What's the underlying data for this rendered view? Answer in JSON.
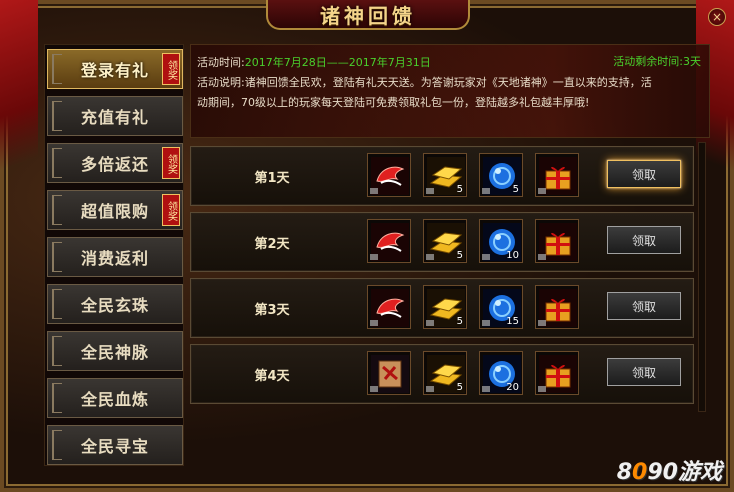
{
  "window": {
    "title": "诸神回馈",
    "close_label": "×"
  },
  "sidebar": {
    "items": [
      {
        "label": "登录有礼",
        "badge": "领奖",
        "active": true
      },
      {
        "label": "充值有礼",
        "badge": ""
      },
      {
        "label": "多倍返还",
        "badge": "领奖"
      },
      {
        "label": "超值限购",
        "badge": "领奖"
      },
      {
        "label": "消费返利",
        "badge": ""
      },
      {
        "label": "全民玄珠",
        "badge": ""
      },
      {
        "label": "全民神脉",
        "badge": ""
      },
      {
        "label": "全民血炼",
        "badge": ""
      },
      {
        "label": "全民寻宝",
        "badge": ""
      }
    ]
  },
  "info": {
    "time_label": "活动时间:",
    "time_value": "2017年7月28日——2017年7月31日",
    "remain_label": "活动剩余时间:",
    "remain_value": "3天",
    "desc_label": "活动说明:",
    "desc_line1": "诸神回馈全民欢，登陆有礼天天送。为答谢玩家对《天地诸神》一直以来的支持，活",
    "desc_line2": "动期间，70级以上的玩家每天登陆可免费领取礼包一份，登陆越多礼包越丰厚哦!"
  },
  "rows": [
    {
      "day": "第1天",
      "items": [
        {
          "icon": "red-wing-icon",
          "qty": ""
        },
        {
          "icon": "gold-bars-icon",
          "qty": "5"
        },
        {
          "icon": "blue-orb-icon",
          "qty": "5"
        },
        {
          "icon": "gift-box-icon",
          "qty": ""
        }
      ],
      "button": "领取",
      "highlight": true
    },
    {
      "day": "第2天",
      "items": [
        {
          "icon": "red-wing-icon",
          "qty": ""
        },
        {
          "icon": "gold-bars-icon",
          "qty": "5"
        },
        {
          "icon": "blue-orb-icon",
          "qty": "10"
        },
        {
          "icon": "gift-box-icon",
          "qty": ""
        }
      ],
      "button": "领取"
    },
    {
      "day": "第3天",
      "items": [
        {
          "icon": "red-wing-icon",
          "qty": ""
        },
        {
          "icon": "gold-bars-icon",
          "qty": "5"
        },
        {
          "icon": "blue-orb-icon",
          "qty": "15"
        },
        {
          "icon": "gift-box-icon",
          "qty": ""
        }
      ],
      "button": "领取"
    },
    {
      "day": "第4天",
      "items": [
        {
          "icon": "scroll-icon",
          "qty": ""
        },
        {
          "icon": "gold-bars-icon",
          "qty": "5"
        },
        {
          "icon": "blue-orb-icon",
          "qty": "20"
        },
        {
          "icon": "gift-box-icon",
          "qty": ""
        }
      ],
      "button": "领取"
    }
  ],
  "watermark": {
    "text_a": "8",
    "text_b": "0",
    "text_c": "90",
    "text_d": "游戏"
  },
  "colors": {
    "accent_gold": "#f4d48a",
    "green_text": "#4ad02c",
    "badge_red": "#b01010"
  }
}
